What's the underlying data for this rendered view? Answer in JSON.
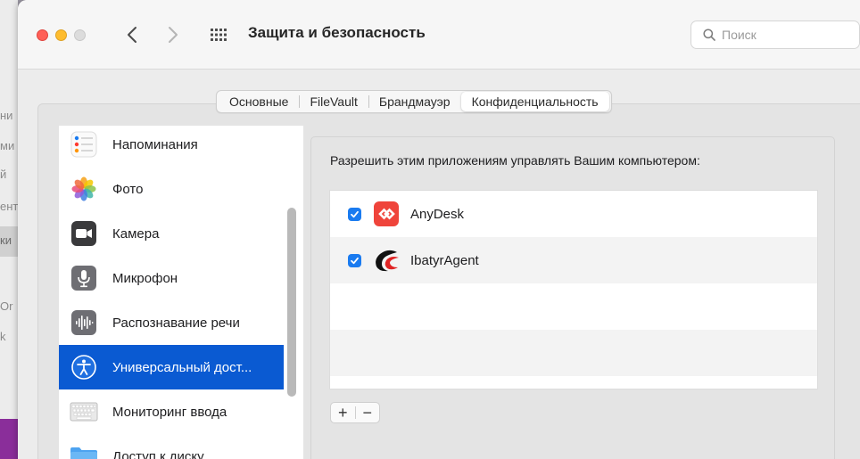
{
  "window": {
    "title": "Защита и безопасность"
  },
  "search": {
    "placeholder": "Поиск"
  },
  "tabs": [
    {
      "label": "Основные",
      "active": false
    },
    {
      "label": "FileVault",
      "active": false
    },
    {
      "label": "Брандмауэр",
      "active": false
    },
    {
      "label": "Конфиденциальность",
      "active": true
    }
  ],
  "sidebar": {
    "items": [
      {
        "label": "Напоминания",
        "icon": "reminders-icon"
      },
      {
        "label": "Фото",
        "icon": "photos-icon"
      },
      {
        "label": "Камера",
        "icon": "camera-icon"
      },
      {
        "label": "Микрофон",
        "icon": "microphone-icon"
      },
      {
        "label": "Распознавание речи",
        "icon": "speech-recognition-icon"
      },
      {
        "label": "Универсальный дост...",
        "icon": "accessibility-icon",
        "selected": true
      },
      {
        "label": "Мониторинг ввода",
        "icon": "keyboard-icon"
      },
      {
        "label": "Доступ к диску",
        "icon": "folder-icon"
      }
    ]
  },
  "permissions": {
    "label": "Разрешить этим приложениям управлять Вашим компьютером:",
    "apps": [
      {
        "name": "AnyDesk",
        "checked": true,
        "icon": "anydesk-icon"
      },
      {
        "name": "IbatyrAgent",
        "checked": true,
        "icon": "ibatyragent-icon"
      }
    ],
    "add_label": "+",
    "remove_label": "−"
  },
  "background_fragments": [
    "ни",
    "ми",
    "й",
    "ент",
    "ки",
    "Or",
    "k"
  ],
  "colors": {
    "selection": "#0a5ad2",
    "checkbox": "#1a7bf0",
    "close": "#ff5f57",
    "minimize": "#febc2e",
    "anydesk": "#ef443b"
  }
}
